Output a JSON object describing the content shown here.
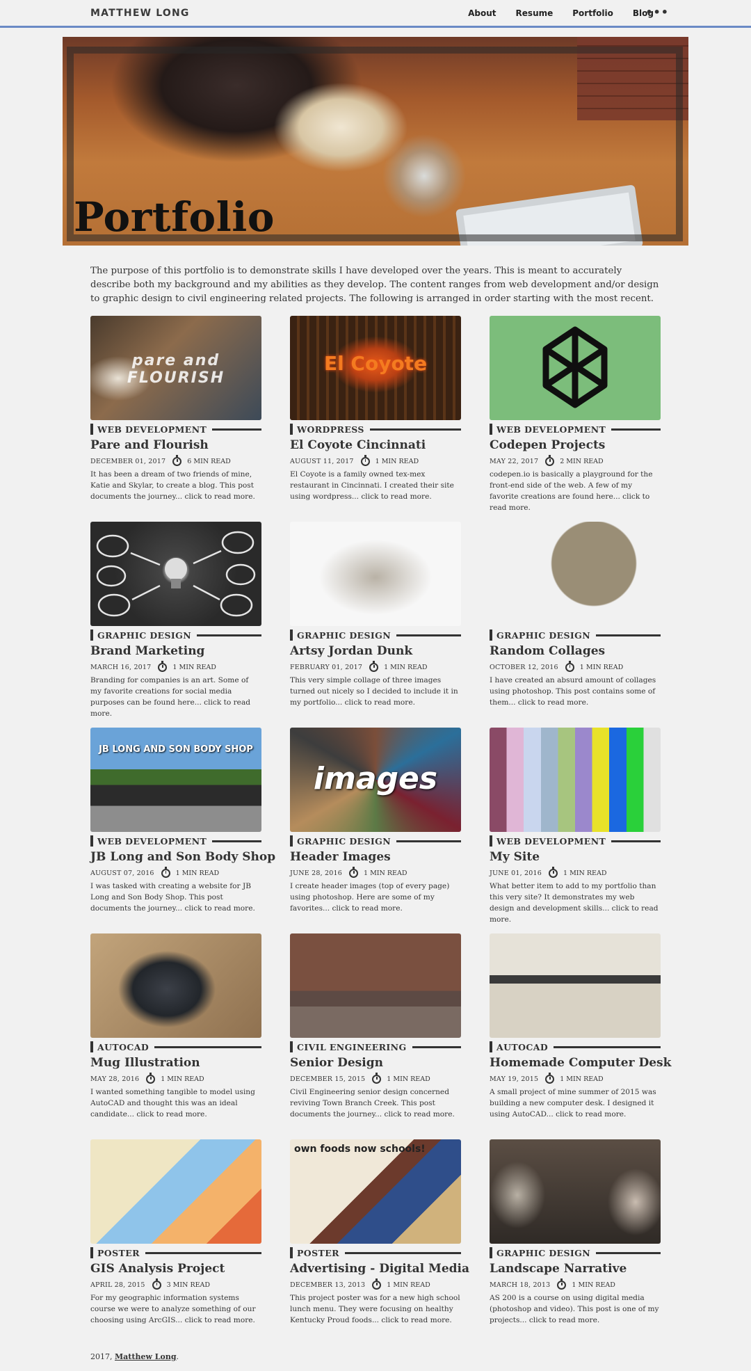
{
  "nav": {
    "brand": "MATTHEW LONG",
    "links": [
      "About",
      "Resume",
      "Portfolio",
      "Blog"
    ],
    "more": "•••"
  },
  "hero": {
    "title": "Portfolio"
  },
  "intro": "The purpose of this portfolio is to demonstrate skills I have developed over the years. This is meant to accurately describe both my background and my abilities as they develop. The content ranges from web development and/or design to graphic design to civil engineering related projects. The following is arranged in order starting with the most recent.",
  "posts": [
    {
      "category": "WEB DEVELOPMENT",
      "title": "Pare and Flourish",
      "date": "DECEMBER 01, 2017",
      "read": "6 MIN READ",
      "desc": "It has been a dream of two friends of mine, Katie and Skylar, to create a blog. This post documents the journey... click to read more.",
      "thumb_text": "pare and FLOURISH"
    },
    {
      "category": "WORDPRESS",
      "title": "El Coyote Cincinnati",
      "date": "AUGUST 11, 2017",
      "read": "1 MIN READ",
      "desc": "El Coyote is a family owned tex-mex restaurant in Cincinnati. I created their site using wordpress... click to read more.",
      "thumb_text": "El Coyote"
    },
    {
      "category": "WEB DEVELOPMENT",
      "title": "Codepen Projects",
      "date": "MAY 22, 2017",
      "read": "2 MIN READ",
      "desc": "codepen.io is basically a playground for the front-end side of the web. A few of my favorite creations are found here... click to read more.",
      "thumb_text": ""
    },
    {
      "category": "GRAPHIC DESIGN",
      "title": "Brand Marketing",
      "date": "MARCH 16, 2017",
      "read": "1 MIN READ",
      "desc": "Branding for companies is an art. Some of my favorite creations for social media purposes can be found here... click to read more.",
      "thumb_text": ""
    },
    {
      "category": "GRAPHIC DESIGN",
      "title": "Artsy Jordan Dunk",
      "date": "FEBRUARY 01, 2017",
      "read": "1 MIN READ",
      "desc": "This very simple collage of three images turned out nicely so I decided to include it in my portfolio... click to read more.",
      "thumb_text": ""
    },
    {
      "category": "GRAPHIC DESIGN",
      "title": "Random Collages",
      "date": "OCTOBER 12, 2016",
      "read": "1 MIN READ",
      "desc": "I have created an absurd amount of collages using photoshop. This post contains some of them... click to read more.",
      "thumb_text": ""
    },
    {
      "category": "WEB DEVELOPMENT",
      "title": "JB Long and Son Body Shop",
      "date": "AUGUST 07, 2016",
      "read": "1 MIN READ",
      "desc": "I was tasked with creating a website for JB Long and Son Body Shop. This post documents the journey... click to read more.",
      "thumb_text": "JB LONG AND SON BODY SHOP"
    },
    {
      "category": "GRAPHIC DESIGN",
      "title": "Header Images",
      "date": "JUNE 28, 2016",
      "read": "1 MIN READ",
      "desc": "I create header images (top of every page) using photoshop. Here are some of my favorites... click to read more.",
      "thumb_text": "images"
    },
    {
      "category": "WEB DEVELOPMENT",
      "title": "My Site",
      "date": "JUNE 01, 2016",
      "read": "1 MIN READ",
      "desc": "What better item to add to my portfolio than this very site? It demonstrates my web design and development skills... click to read more.",
      "thumb_text": ""
    },
    {
      "category": "AUTOCAD",
      "title": "Mug Illustration",
      "date": "MAY 28, 2016",
      "read": "1 MIN READ",
      "desc": "I wanted something tangible to model using AutoCAD and thought this was an ideal candidate... click to read more.",
      "thumb_text": ""
    },
    {
      "category": "CIVIL ENGINEERING",
      "title": "Senior Design",
      "date": "DECEMBER 15, 2015",
      "read": "1 MIN READ",
      "desc": "Civil Engineering senior design concerned reviving Town Branch Creek. This post documents the journey... click to read more.",
      "thumb_text": ""
    },
    {
      "category": "AUTOCAD",
      "title": "Homemade Computer Desk",
      "date": "MAY 19, 2015",
      "read": "1 MIN READ",
      "desc": "A small project of mine summer of 2015 was building a new computer desk. I designed it using AutoCAD... click to read more.",
      "thumb_text": ""
    },
    {
      "category": "POSTER",
      "title": "GIS Analysis Project",
      "date": "APRIL 28, 2015",
      "read": "3 MIN READ",
      "desc": "For my geographic information systems course we were to analyze something of our choosing using ArcGIS... click to read more.",
      "thumb_text": ""
    },
    {
      "category": "POSTER",
      "title": "Advertising - Digital Media",
      "date": "DECEMBER 13, 2013",
      "read": "1 MIN READ",
      "desc": "This project poster was for a new high school lunch menu. They were focusing on healthy Kentucky Proud foods... click to read more.",
      "thumb_text": "own foods now schools!"
    },
    {
      "category": "GRAPHIC DESIGN",
      "title": "Landscape Narrative",
      "date": "MARCH 18, 2013",
      "read": "1 MIN READ",
      "desc": "AS 200 is a course on using digital media (photoshop and video). This post is one of my projects... click to read more.",
      "thumb_text": ""
    }
  ],
  "footer": {
    "year": "2017,",
    "name": "Matthew Long",
    "end": "."
  },
  "colors": {
    "accent": "#6a8ac5",
    "background": "#f1f1f1",
    "text": "#333333"
  }
}
